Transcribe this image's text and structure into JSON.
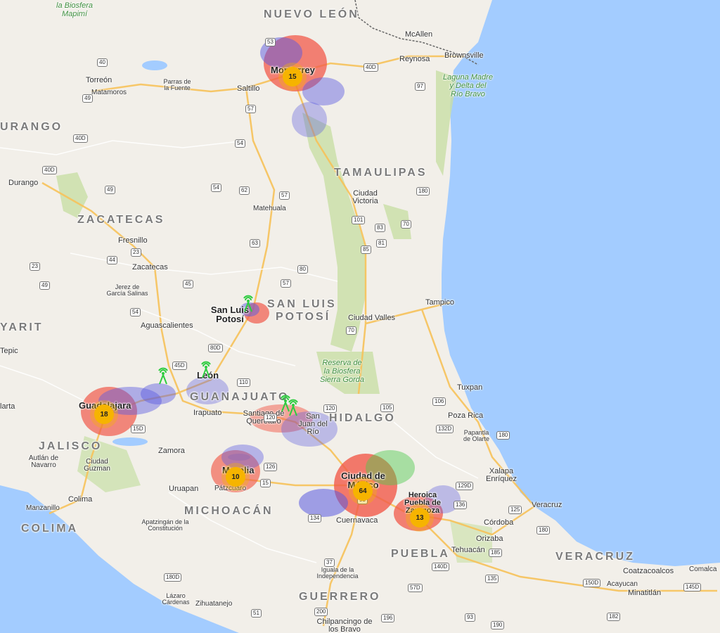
{
  "map": {
    "states": [
      {
        "id": "nuevo-leon",
        "text": "NUEVO LEÓN"
      },
      {
        "id": "durango",
        "text": "URANGO"
      },
      {
        "id": "tamaulipas",
        "text": "TAMAULIPAS"
      },
      {
        "id": "zacatecas",
        "text": "ZACATECAS"
      },
      {
        "id": "san-luis-potosi-1",
        "text": "SAN LUIS"
      },
      {
        "id": "san-luis-potosi-2",
        "text": "POTOSÍ"
      },
      {
        "id": "nayarit",
        "text": "YARIT"
      },
      {
        "id": "guanajuato",
        "text": "GUANAJUATO"
      },
      {
        "id": "hidalgo",
        "text": "HIDALGO"
      },
      {
        "id": "jalisco",
        "text": "JALISCO"
      },
      {
        "id": "michoacan",
        "text": "MICHOACÁN"
      },
      {
        "id": "colima",
        "text": "COLIMA"
      },
      {
        "id": "puebla",
        "text": "PUEBLA"
      },
      {
        "id": "veracruz",
        "text": "VERACRUZ"
      },
      {
        "id": "guerrero",
        "text": "GUERRERO"
      }
    ],
    "cities": [
      {
        "id": "mcallen",
        "text": "McAllen"
      },
      {
        "id": "reynosa",
        "text": "Reynosa"
      },
      {
        "id": "brownsville",
        "text": "Brownsville"
      },
      {
        "id": "torreon",
        "text": "Torreón"
      },
      {
        "id": "matamoros",
        "text": "Matamoros"
      },
      {
        "id": "parras",
        "text": "Parras de la Fuente"
      },
      {
        "id": "saltillo",
        "text": "Saltillo"
      },
      {
        "id": "durango-city",
        "text": "Durango"
      },
      {
        "id": "ciudad-victoria",
        "text": "Ciudad Victoria"
      },
      {
        "id": "matehuala",
        "text": "Matehuala"
      },
      {
        "id": "fresnillo",
        "text": "Fresnillo"
      },
      {
        "id": "zacatecas-city",
        "text": "Zacatecas"
      },
      {
        "id": "jerez",
        "text": "Jerez de García Salinas"
      },
      {
        "id": "tampico",
        "text": "Tampico"
      },
      {
        "id": "ciudad-valles",
        "text": "Ciudad Valles"
      },
      {
        "id": "aguascalientes",
        "text": "Aguascalientes"
      },
      {
        "id": "tepic",
        "text": "Tepic"
      },
      {
        "id": "irapuato",
        "text": "Irapuato"
      },
      {
        "id": "queretaro",
        "text": "Santiago de Querétaro"
      },
      {
        "id": "san-juan-del-rio",
        "text": "San Juan del Río"
      },
      {
        "id": "tuxpan",
        "text": "Tuxpan"
      },
      {
        "id": "poza-rica",
        "text": "Poza Rica"
      },
      {
        "id": "papantla",
        "text": "Papantla de Olarte"
      },
      {
        "id": "vallarta",
        "text": "larta"
      },
      {
        "id": "zamora",
        "text": "Zamora"
      },
      {
        "id": "autlan",
        "text": "Autlán de Navarro"
      },
      {
        "id": "ciudad-guzman",
        "text": "Ciudad Guzman"
      },
      {
        "id": "xalapa",
        "text": "Xalapa Enríquez"
      },
      {
        "id": "uruapan",
        "text": "Uruapan"
      },
      {
        "id": "patzcuaro",
        "text": "Pátzcuaro"
      },
      {
        "id": "colima-city",
        "text": "Colima"
      },
      {
        "id": "manzanillo",
        "text": "Manzanillo"
      },
      {
        "id": "apatzingan",
        "text": "Apatzingán de la Constitución"
      },
      {
        "id": "veracruz-city",
        "text": "Veracruz"
      },
      {
        "id": "cordoba",
        "text": "Córdoba"
      },
      {
        "id": "orizaba",
        "text": "Orizaba"
      },
      {
        "id": "cuernavaca",
        "text": "Cuernavaca"
      },
      {
        "id": "tehuacan",
        "text": "Tehuacán"
      },
      {
        "id": "iguala",
        "text": "Iguala de la Independencia"
      },
      {
        "id": "coatzacoalcos",
        "text": "Coatzacoalcos"
      },
      {
        "id": "comalcalco",
        "text": "Comalca"
      },
      {
        "id": "acayucan",
        "text": "Acayucan"
      },
      {
        "id": "minatitlan",
        "text": "Minatitlán"
      },
      {
        "id": "lazaro-cardenas",
        "text": "Lázaro Cárdenas"
      },
      {
        "id": "zihuatanejo",
        "text": "Zihuatanejo"
      },
      {
        "id": "chilpancingo",
        "text": "Chilpancingo de los Bravo"
      }
    ],
    "big_cities": [
      {
        "id": "monterrey",
        "text": "Monterrey"
      },
      {
        "id": "san-luis-potosi-city",
        "text": "San Luis Potosí"
      },
      {
        "id": "leon",
        "text": "León"
      },
      {
        "id": "guadalajara",
        "text": "Guadalajara"
      },
      {
        "id": "morelia",
        "text": "Morelia"
      },
      {
        "id": "mexico-city",
        "text": "Ciudad de México"
      },
      {
        "id": "puebla-city",
        "text": "Heroica Puebla de Zaragoza"
      }
    ],
    "parks": [
      {
        "id": "mapimi",
        "text": "la Biosfera\nMapimí"
      },
      {
        "id": "laguna-madre",
        "text": "Laguna Madre\ny Delta del\nRío Bravo"
      },
      {
        "id": "sierra-gorda",
        "text": "Reserva de\nla Biosfera\nSierra Gorda"
      }
    ],
    "clusters": [
      {
        "id": "monterrey",
        "count": "15"
      },
      {
        "id": "guadalajara",
        "count": "18"
      },
      {
        "id": "morelia",
        "count": "10"
      },
      {
        "id": "mexico-city",
        "count": "64"
      },
      {
        "id": "puebla",
        "count": "13"
      }
    ],
    "towers": [
      {
        "id": "san-luis-potosi"
      },
      {
        "id": "guadalajara-east"
      },
      {
        "id": "leon"
      },
      {
        "id": "queretaro-1"
      },
      {
        "id": "queretaro-2"
      }
    ],
    "highways": [
      "53",
      "40D",
      "40",
      "49",
      "57",
      "97",
      "40D",
      "54",
      "40D",
      "49",
      "54",
      "62",
      "57",
      "101",
      "180",
      "83",
      "70",
      "85",
      "81",
      "63",
      "80",
      "45",
      "23",
      "44",
      "23",
      "49",
      "54",
      "57",
      "70",
      "80D",
      "45D",
      "110",
      "120",
      "105",
      "106",
      "180",
      "132D",
      "15D",
      "120",
      "15",
      "126",
      "129D",
      "136",
      "125",
      "180",
      "134",
      "95",
      "150D",
      "145D",
      "180D",
      "37",
      "51",
      "200",
      "196",
      "93",
      "190",
      "135",
      "182",
      "185",
      "140D",
      "57D",
      "85"
    ],
    "colors": {
      "land": "#f2efe9",
      "water": "#a3ccff",
      "park": "#c8dfa5",
      "road_major": "#f7c25a",
      "road_minor": "#ffffff",
      "coverage_red": "#f15a4a",
      "coverage_blue": "#5a5ae0",
      "coverage_green": "#4cc94c",
      "cluster": "#f6b400"
    }
  }
}
